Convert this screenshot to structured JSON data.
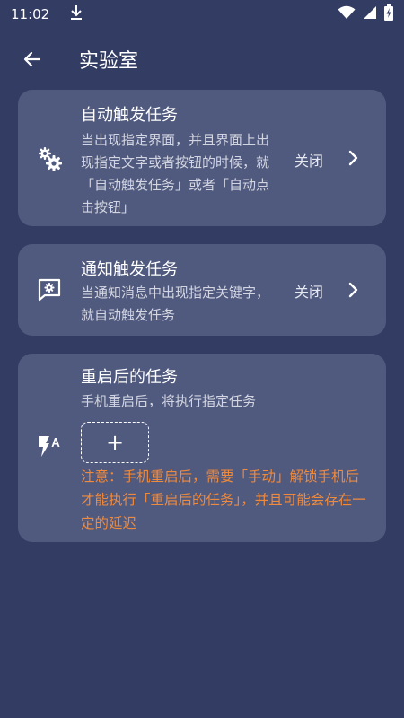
{
  "status_bar": {
    "time": "11:02",
    "icons": [
      "download-icon",
      "wifi-icon",
      "signal-icon",
      "battery-charging-icon"
    ]
  },
  "app_bar": {
    "title": "实验室",
    "back_icon": "arrow-left-icon"
  },
  "cards": [
    {
      "icon": "gears-icon",
      "title": "自动触发任务",
      "description": "当出现指定界面，并且界面上出现指定文字或者按钮的时候，就「自动触发任务」或者「自动点击按钮」",
      "status": "关闭"
    },
    {
      "icon": "notification-settings-icon",
      "title": "通知触发任务",
      "description": "当通知消息中出现指定关键字，就自动触发任务",
      "status": "关闭"
    },
    {
      "icon": "flash-auto-icon",
      "title": "重启后的任务",
      "description": "手机重启后，将执行指定任务",
      "add_label": "+",
      "warning": "注意：手机重启后，需要「手动」解锁手机后才能执行「重启后的任务」，并且可能会存在一定的延迟"
    }
  ],
  "colors": {
    "background": "#333c62",
    "card": "#50597e",
    "warning": "#f08a3c"
  }
}
